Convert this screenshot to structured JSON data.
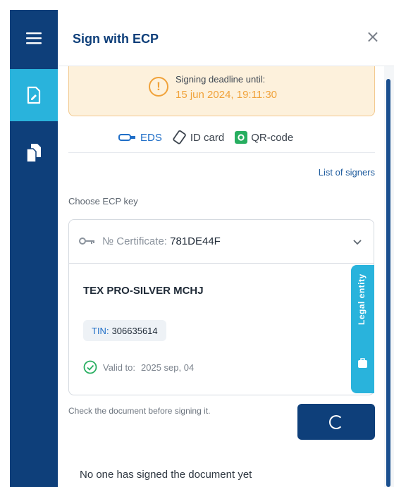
{
  "header": {
    "title": "Sign with ECP",
    "close_glyph": "×"
  },
  "sidebar": {
    "items": [
      {
        "icon": "menu-icon"
      },
      {
        "icon": "document-sign-icon",
        "active": true
      },
      {
        "icon": "documents-copy-icon"
      }
    ]
  },
  "deadline": {
    "label": "Signing deadline until:",
    "value": "15 jun 2024, 19:11:30",
    "icon_glyph": "!"
  },
  "methods": {
    "eds": "EDS",
    "id_card": "ID card",
    "qr": "QR-code"
  },
  "links": {
    "signers": "List of signers"
  },
  "form": {
    "choose_label": "Choose ECP key",
    "certificate_prefix": "№ Certificate:",
    "certificate_number": "781DE44F"
  },
  "card": {
    "organization": "TEX PRO-SILVER MCHJ",
    "tin_label": "TIN:",
    "tin_value": "306635614",
    "valid_label": "Valid to:",
    "valid_value": "2025 sep, 04",
    "entity_tab": "Legal entity"
  },
  "footer": {
    "check_text": "Check the document before signing it.",
    "status": "No one has signed the document yet"
  },
  "colors": {
    "navy": "#0e3f7a",
    "accent_blue": "#29b3dc",
    "warning_orange": "#f0a23a",
    "warning_bg": "#fdf1dc",
    "success_green": "#27ae60",
    "link_blue": "#1f6ec7"
  }
}
